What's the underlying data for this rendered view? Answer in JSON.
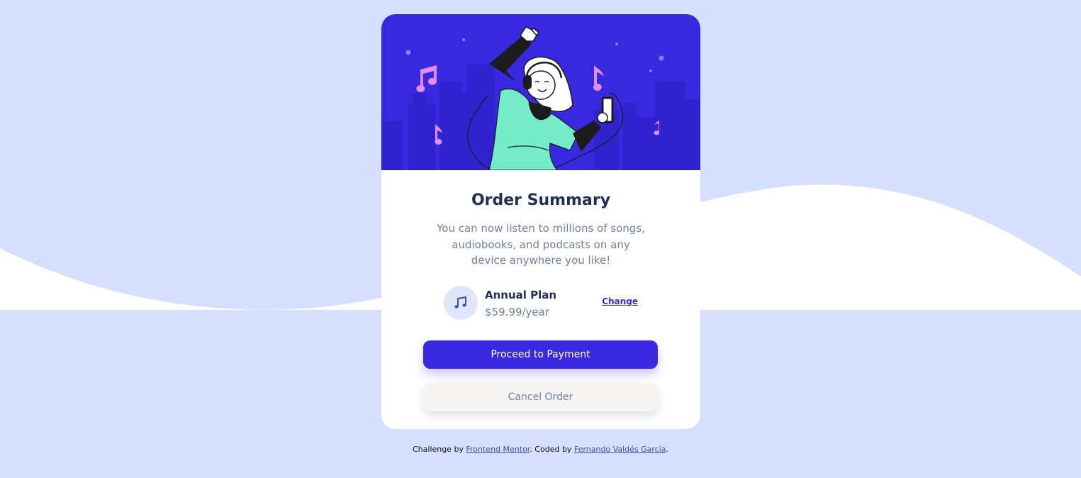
{
  "colors": {
    "page_background": "#d5e0fe",
    "wave": "#ffffff",
    "hero_background": "#3829e0",
    "primary": "#3829e0",
    "title": "#1f2f56",
    "desc": "#717fa6"
  },
  "card": {
    "title": "Order Summary",
    "description": "You can now listen to millions of songs, audiobooks, and podcasts on any device anywhere you like!",
    "illustration": "woman-dancing-with-headphones-illustration"
  },
  "plan": {
    "icon": "music-note-icon",
    "name": "Annual Plan",
    "price": "$59.99/year",
    "change_label": "Change"
  },
  "buttons": {
    "proceed_label": "Proceed to Payment",
    "cancel_label": "Cancel Order"
  },
  "attribution": {
    "prefix": "Challenge by ",
    "frontend_mentor": "Frontend Mentor",
    "middle": ". Coded by ",
    "author": "Fernando Valdés García",
    "suffix": "."
  }
}
